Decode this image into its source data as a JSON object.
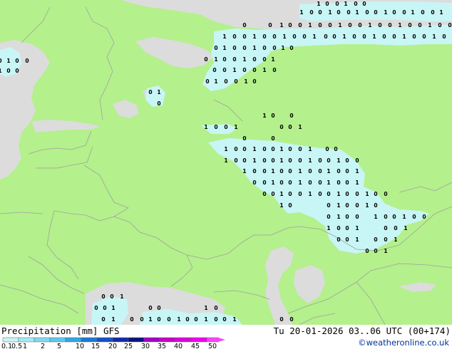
{
  "legend": {
    "title": "Precipitation [mm]",
    "model": "GFS",
    "valid": "Tu 20-01-2026 03..06 UTC (00+174)",
    "credit": "©weatheronline.co.uk",
    "ticks": [
      "0.1",
      "0.5",
      "1",
      "2",
      "5",
      "10",
      "15",
      "20",
      "25",
      "30",
      "35",
      "40",
      "45",
      "50"
    ],
    "colors": [
      "#c8f5f5",
      "#a0ebf5",
      "#7ed9f0",
      "#5ac8ee",
      "#2fa6e6",
      "#1a78d8",
      "#1450c8",
      "#1428a8",
      "#0a1480",
      "#a000c8",
      "#c800c8",
      "#dc00dc",
      "#f000f0",
      "#ff40ff"
    ]
  },
  "map": {
    "land_color": "#b4f08c",
    "sea_color": "#dcdcdc",
    "precip_color": "#c8f5f5",
    "border_color": "#a0a0a0"
  },
  "chart_data": {
    "type": "map",
    "variable": "Precipitation [mm]",
    "model": "GFS",
    "valid_time": "Tu 20-01-2026 03..06 UTC (00+174)",
    "cell_values": [
      "0",
      "1"
    ]
  }
}
